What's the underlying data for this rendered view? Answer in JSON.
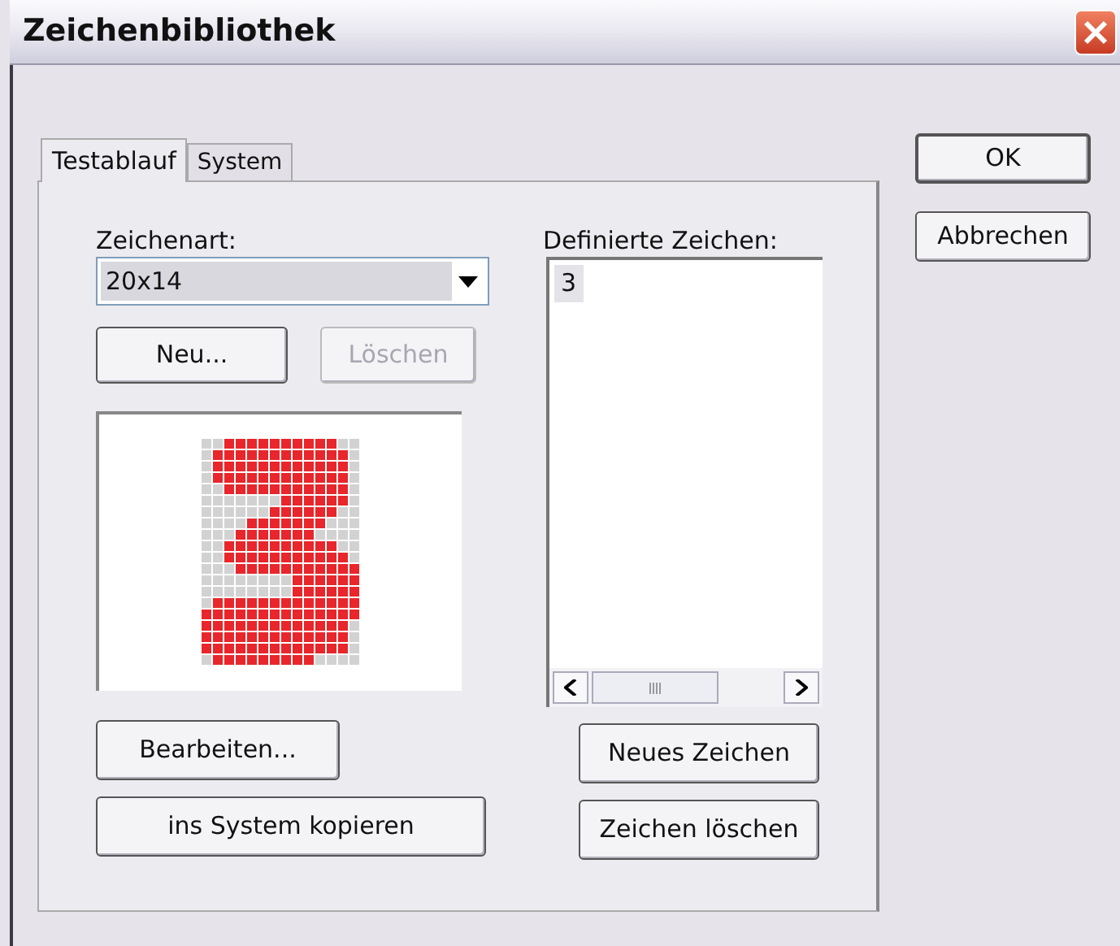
{
  "window": {
    "title": "Zeichenbibliothek"
  },
  "tabs": [
    {
      "label": "Testablauf",
      "selected": true
    },
    {
      "label": "System",
      "selected": false
    }
  ],
  "character_type": {
    "label": "Zeichenart:",
    "value": "20x14"
  },
  "left_buttons": [
    {
      "label": "Neu...",
      "disabled": false
    },
    {
      "label": "Löschen",
      "disabled": true
    }
  ],
  "bottom_left_buttons": [
    {
      "label": "Bearbeiten..."
    },
    {
      "label": "ins System kopieren"
    }
  ],
  "defined_characters": {
    "label": "Definierte Zeichen:",
    "items": [
      {
        "label": "3",
        "selected": true
      }
    ]
  },
  "right_buttons": [
    {
      "label": "Neues Zeichen"
    },
    {
      "label": "Zeichen löschen"
    }
  ],
  "dialog_buttons": [
    {
      "label": "OK",
      "default": true
    },
    {
      "label": "Abbrechen",
      "default": false
    }
  ]
}
